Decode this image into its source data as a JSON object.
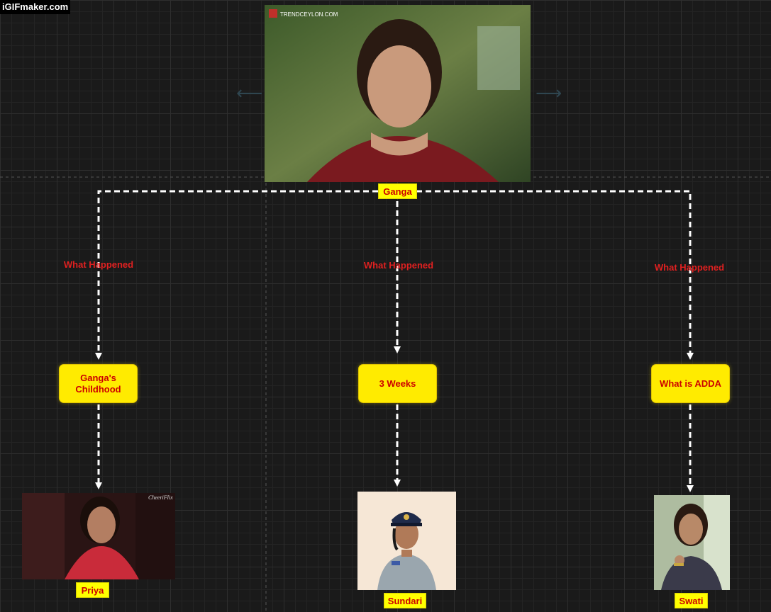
{
  "watermark": "iGIFmaker.com",
  "root": {
    "name": "Ganga",
    "photo_caption": "TRENDCEYLON.COM"
  },
  "branches": [
    {
      "edge_label": "What Happened",
      "node_label": "Ganga's Childhood",
      "child": {
        "name": "Priya",
        "photo_caption": "CheeriFlix"
      }
    },
    {
      "edge_label": "What Happened",
      "node_label": "3 Weeks",
      "child": {
        "name": "Sundari"
      }
    },
    {
      "edge_label": "What Happened",
      "node_label": "What is ADDA",
      "child": {
        "name": "Swati"
      }
    }
  ],
  "colors": {
    "canvas": "#1a1a1a",
    "node_fill": "#ffeb00",
    "label_fill": "#ffff00",
    "text_red": "#cc0000",
    "connector": "#ffffff"
  },
  "icons": [
    "arrow-left-icon",
    "arrow-right-icon"
  ]
}
